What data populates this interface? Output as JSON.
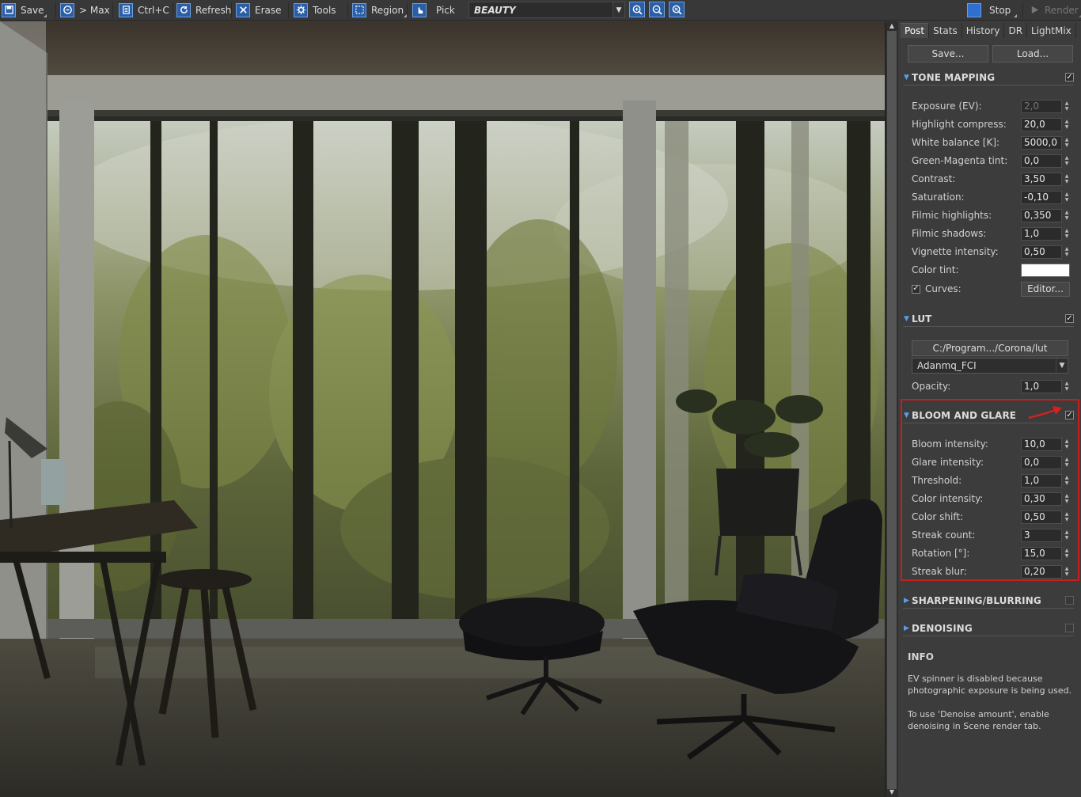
{
  "toolbar": {
    "save": "Save",
    "max": "> Max",
    "copy": "Ctrl+C",
    "refresh": "Refresh",
    "erase": "Erase",
    "tools": "Tools",
    "region": "Region",
    "pick": "Pick",
    "render_pass": "BEAUTY",
    "stop": "Stop",
    "render": "Render"
  },
  "panel": {
    "tabs": [
      "Post",
      "Stats",
      "History",
      "DR",
      "LightMix"
    ],
    "active_tab": "Post",
    "save_btn": "Save...",
    "load_btn": "Load...",
    "tone_mapping": {
      "title": "TONE MAPPING",
      "enabled": true,
      "rows": [
        {
          "label": "Exposure (EV):",
          "value": "2,0",
          "disabled": true
        },
        {
          "label": "Highlight compress:",
          "value": "20,0"
        },
        {
          "label": "White balance [K]:",
          "value": "5000,0"
        },
        {
          "label": "Green-Magenta tint:",
          "value": "0,0"
        },
        {
          "label": "Contrast:",
          "value": "3,50"
        },
        {
          "label": "Saturation:",
          "value": "-0,10"
        },
        {
          "label": "Filmic highlights:",
          "value": "0,350"
        },
        {
          "label": "Filmic shadows:",
          "value": "1,0"
        },
        {
          "label": "Vignette intensity:",
          "value": "0,50"
        }
      ],
      "color_tint_label": "Color tint:",
      "color_tint": "#ffffff",
      "curves_label": "Curves:",
      "curves_checked": true,
      "editor_btn": "Editor..."
    },
    "lut": {
      "title": "LUT",
      "enabled": true,
      "path": "C:/Program.../Corona/lut",
      "selected": "Adanmq_FCI",
      "opacity_label": "Opacity:",
      "opacity": "1,0"
    },
    "bloom_glare": {
      "title": "BLOOM AND GLARE",
      "enabled": true,
      "rows": [
        {
          "label": "Bloom intensity:",
          "value": "10,0"
        },
        {
          "label": "Glare intensity:",
          "value": "0,0"
        },
        {
          "label": "Threshold:",
          "value": "1,0"
        },
        {
          "label": "Color intensity:",
          "value": "0,30"
        },
        {
          "label": "Color shift:",
          "value": "0,50"
        },
        {
          "label": "Streak count:",
          "value": "3"
        },
        {
          "label": "Rotation [°]:",
          "value": "15,0"
        },
        {
          "label": "Streak blur:",
          "value": "0,20"
        }
      ]
    },
    "sharpening": {
      "title": "SHARPENING/BLURRING",
      "enabled": false
    },
    "denoising": {
      "title": "DENOISING",
      "enabled": false
    },
    "info": {
      "title": "INFO",
      "text1": "EV spinner is disabled because photographic exposure is being used.",
      "text2": "To use 'Denoise amount', enable denoising in Scene render tab."
    }
  },
  "colors": {
    "accent": "#2a5fa8",
    "highlight_border": "#c81e1e",
    "panel_bg": "#3c3c3c"
  }
}
